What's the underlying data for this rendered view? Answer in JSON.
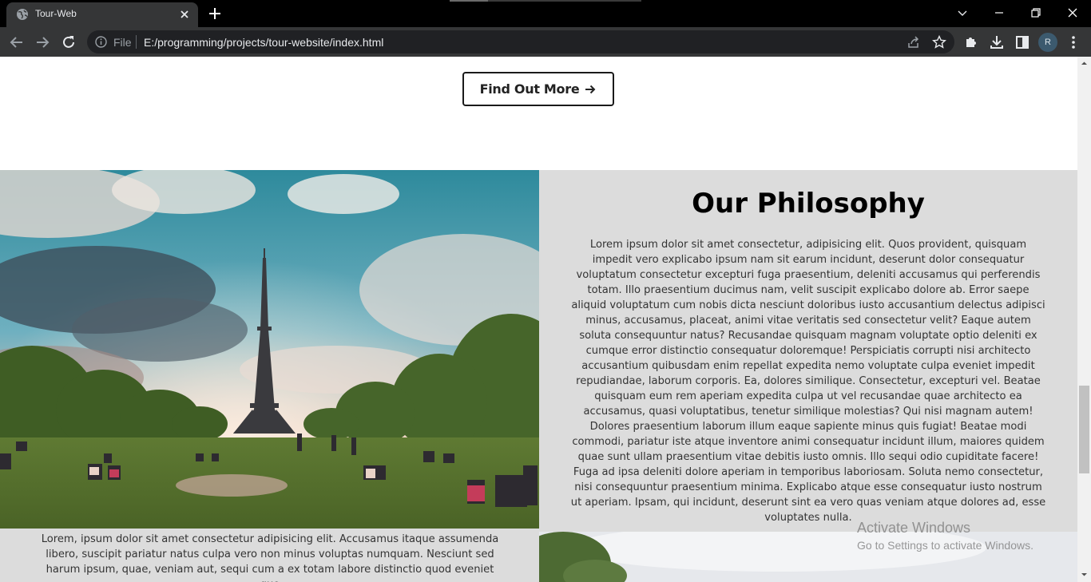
{
  "browser": {
    "tab_title": "Tour-Web",
    "omnibox_scheme_label": "File",
    "url": "E:/programming/projects/tour-website/index.html",
    "profile_initial": "R"
  },
  "page": {
    "cta_label": "Find Out More",
    "philosophy_title": "Our Philosophy",
    "philosophy_text": "Lorem ipsum dolor sit amet consectetur, adipisicing elit. Quos provident, quisquam impedit vero explicabo ipsum nam sit earum incidunt, deserunt dolor consequatur voluptatum consectetur excepturi fuga praesentium, deleniti accusamus qui perferendis totam. Illo praesentium ducimus nam, velit suscipit explicabo dolore ab. Error saepe aliquid voluptatum cum nobis dicta nesciunt doloribus iusto accusantium delectus adipisci minus, accusamus, placeat, animi vitae veritatis sed consectetur velit? Eaque autem soluta consequuntur natus? Recusandae quisquam magnam voluptate optio deleniti ex cumque error distinctio consequatur doloremque! Perspiciatis corrupti nisi architecto accusantium quibusdam enim repellat expedita nemo voluptate culpa eveniet impedit repudiandae, laborum corporis. Ea, dolores similique. Consectetur, excepturi vel. Beatae quisquam eum rem aperiam expedita culpa ut vel recusandae quae architecto ea accusamus, quasi voluptatibus, tenetur similique molestias? Qui nisi magnam autem! Dolores praesentium laborum illum eaque sapiente minus quis fugiat! Beatae modi commodi, pariatur iste atque inventore animi consequatur incidunt illum, maiores quidem quae sunt ullam praesentium vitae debitis iusto omnis. Illo sequi odio cupiditate facere! Fuga ad ipsa deleniti dolore aperiam in temporibus laboriosam. Soluta nemo consectetur, nisi consequuntur praesentium minima. Explicabo atque esse consequatur iusto nostrum ut aperiam. Ipsam, qui incidunt, deserunt sint ea vero quas veniam atque dolores ad, esse voluptates nulla.",
    "lower_text": "Lorem, ipsum dolor sit amet consectetur adipisicing elit. Accusamus itaque assumenda libero, suscipit pariatur natus culpa vero non minus voluptas numquam. Nesciunt sed harum ipsum, quae, veniam aut, sequi cum a ex totam labore distinctio quod eveniet quo"
  },
  "os": {
    "watermark_title": "Activate Windows",
    "watermark_subtitle": "Go to Settings to activate Windows."
  },
  "colors": {
    "chrome_dark": "#000000",
    "toolbar": "#353637",
    "omnibox": "#202124",
    "section_gray": "#dcdcdc"
  }
}
